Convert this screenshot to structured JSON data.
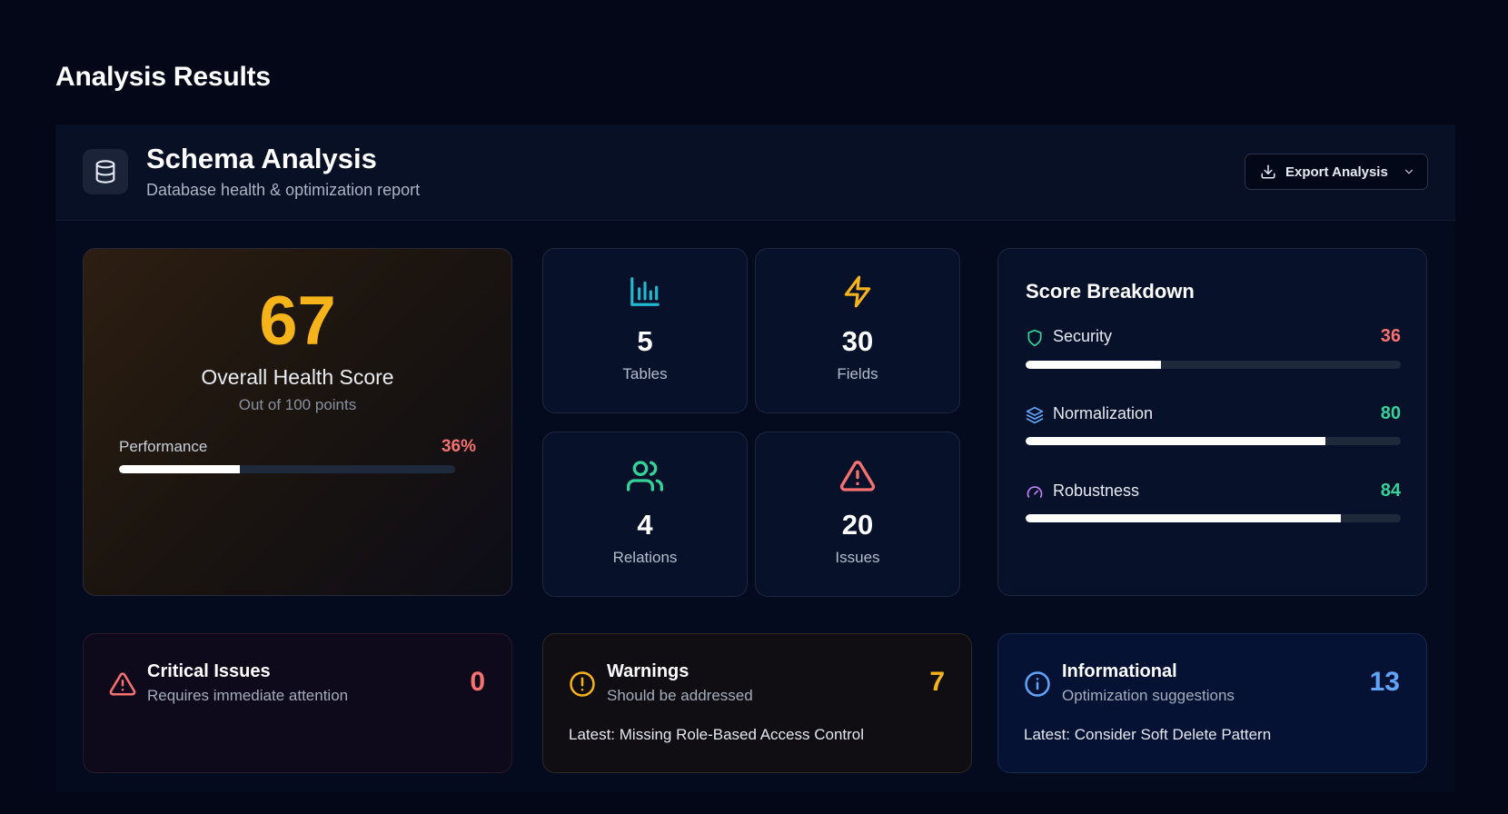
{
  "page": {
    "title": "Analysis Results"
  },
  "header": {
    "title": "Schema Analysis",
    "subtitle": "Database health & optimization report",
    "icon": "database-icon",
    "export_label": "Export Analysis"
  },
  "health": {
    "score": "67",
    "label": "Overall Health Score",
    "sublabel": "Out of 100 points",
    "performance_label": "Performance",
    "performance_value": "36%",
    "performance_fraction": 0.36
  },
  "stats": [
    {
      "value": "5",
      "label": "Tables",
      "icon": "bar-chart-icon",
      "color": "#22b8cf"
    },
    {
      "value": "30",
      "label": "Fields",
      "icon": "lightning-icon",
      "color": "#f6b41a"
    },
    {
      "value": "4",
      "label": "Relations",
      "icon": "users-icon",
      "color": "#34d399"
    },
    {
      "value": "20",
      "label": "Issues",
      "icon": "alert-triangle-icon",
      "color": "#f87171"
    }
  ],
  "breakdown": {
    "title": "Score Breakdown",
    "items": [
      {
        "label": "Security",
        "value": "36",
        "fraction": 0.36,
        "icon": "shield-icon",
        "color": "#f87171"
      },
      {
        "label": "Normalization",
        "value": "80",
        "fraction": 0.8,
        "icon": "layers-icon",
        "color": "#34d399"
      },
      {
        "label": "Robustness",
        "value": "84",
        "fraction": 0.84,
        "icon": "gauge-icon",
        "color": "#34d399"
      }
    ]
  },
  "summary": {
    "critical": {
      "title": "Critical Issues",
      "subtitle": "Requires immediate attention",
      "count": "0",
      "color": "#f87171",
      "icon": "alert-triangle-icon"
    },
    "warnings": {
      "title": "Warnings",
      "subtitle": "Should be addressed",
      "count": "7",
      "latest": "Latest: Missing Role-Based Access Control",
      "color": "#f6b41a",
      "icon": "alert-circle-icon"
    },
    "info": {
      "title": "Informational",
      "subtitle": "Optimization suggestions",
      "count": "13",
      "latest": "Latest: Consider Soft Delete Pattern",
      "color": "#60a5fa",
      "icon": "info-icon"
    }
  }
}
